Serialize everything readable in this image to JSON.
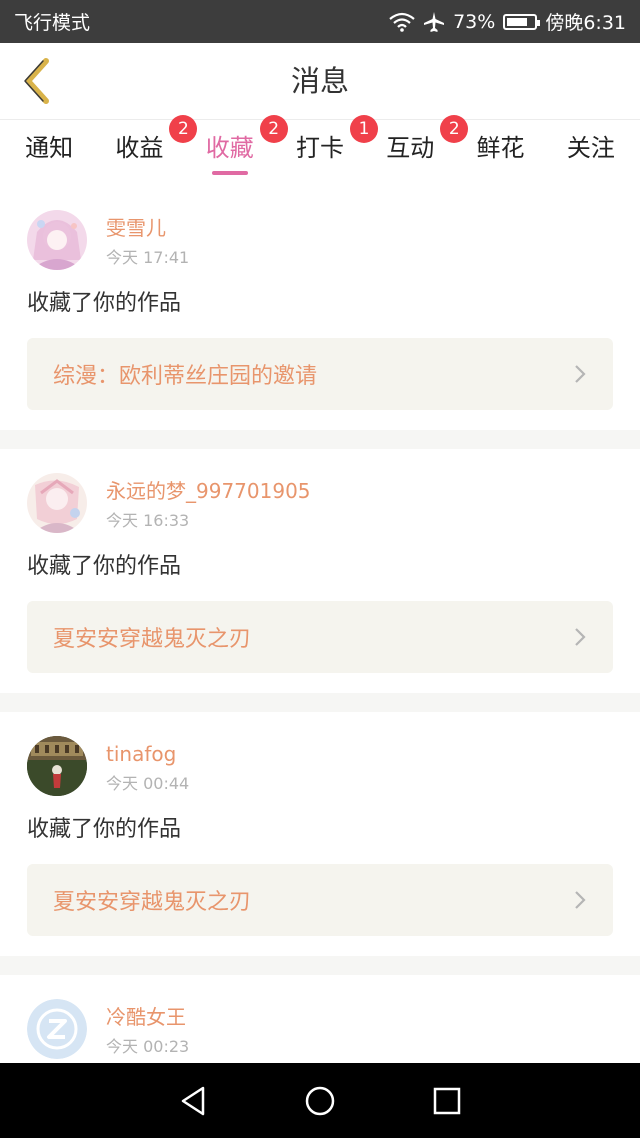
{
  "status_bar": {
    "left_text": "飞行模式",
    "battery_text": "73%",
    "time_text": "傍晚6:31",
    "icons": [
      "wifi-icon",
      "airplane-icon",
      "battery-charging-icon"
    ]
  },
  "header": {
    "title": "消息",
    "back_icon": "chevron-left-icon"
  },
  "tabs": [
    {
      "label": "通知",
      "badge": "",
      "active": false
    },
    {
      "label": "收益",
      "badge": "2",
      "active": false
    },
    {
      "label": "收藏",
      "badge": "2",
      "active": true
    },
    {
      "label": "打卡",
      "badge": "1",
      "active": false
    },
    {
      "label": "互动",
      "badge": "2",
      "active": false
    },
    {
      "label": "鲜花",
      "badge": "",
      "active": false
    },
    {
      "label": "关注",
      "badge": "",
      "active": false
    }
  ],
  "messages": [
    {
      "user": "雯雪儿",
      "time": "今天 17:41",
      "action": "收藏了你的作品",
      "work": "综漫：欧利蒂丝庄园的邀请"
    },
    {
      "user": "永远的梦_997701905",
      "time": "今天 16:33",
      "action": "收藏了你的作品",
      "work": "夏安安穿越鬼灭之刃"
    },
    {
      "user": "tinafog",
      "time": "今天 00:44",
      "action": "收藏了你的作品",
      "work": "夏安安穿越鬼灭之刃"
    },
    {
      "user": "冷酷女王",
      "time": "今天 00:23",
      "action": "",
      "work": ""
    }
  ],
  "colors": {
    "accent": "#e06aa3",
    "name": "#e8956c",
    "badge": "#f0404a",
    "back_arrow": "#d9b34a"
  },
  "nav_bar": {
    "icons": [
      "back-triangle-icon",
      "home-circle-icon",
      "recents-square-icon"
    ]
  }
}
